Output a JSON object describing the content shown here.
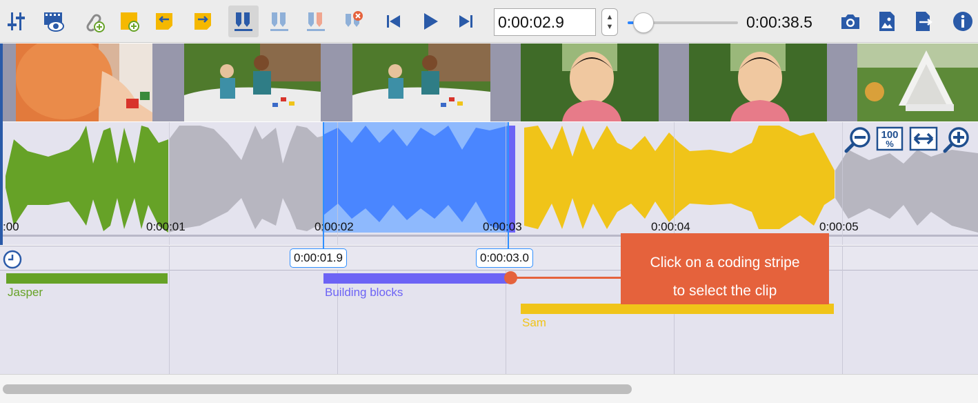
{
  "toolbar": {
    "current_time": "0:00:02.9",
    "total_time": "0:00:38.5",
    "playback_position": 0.075,
    "stepper_up": "▲",
    "stepper_down": "▼",
    "buttons": [
      {
        "name": "sliders-icon"
      },
      {
        "name": "preview-clip-icon"
      },
      {
        "name": "link-add-icon"
      },
      {
        "name": "note-add-icon"
      },
      {
        "name": "note-import-icon"
      },
      {
        "name": "note-export-icon"
      },
      {
        "name": "marker-set-icon"
      },
      {
        "name": "marker-add-icon"
      },
      {
        "name": "marker-split-icon"
      },
      {
        "name": "marker-delete-icon"
      },
      {
        "name": "skip-back-icon"
      },
      {
        "name": "play-icon"
      },
      {
        "name": "skip-forward-icon"
      },
      {
        "name": "camera-icon"
      },
      {
        "name": "image-document-icon"
      },
      {
        "name": "export-document-icon"
      },
      {
        "name": "info-icon"
      }
    ]
  },
  "timeline": {
    "tick_labels": [
      ":00",
      "0:00:01",
      "0:00:02",
      "0:00:03",
      "0:00:04",
      "0:00:05"
    ],
    "selection_start": "0:00:01.9",
    "selection_end": "0:00:03.0"
  },
  "zoom_controls": {
    "zoom_out": "zoom-out-icon",
    "fit_100": "100",
    "fit_100_sub": "%",
    "fit_width": "fit-width-icon",
    "zoom_in": "zoom-in-icon"
  },
  "coding_stripes": [
    {
      "label": "Jasper",
      "color": "#66a227"
    },
    {
      "label": "Building blocks",
      "color": "#6c63f5"
    },
    {
      "label": "Sam",
      "color": "#f0c419"
    }
  ],
  "callout": {
    "line1": "Click on a coding stripe",
    "line2": "to select the clip"
  },
  "colors": {
    "accent": "#2f8fff",
    "callout": "#e5623c",
    "waveform_green": "#66a227",
    "waveform_blue": "#4a86ff",
    "waveform_yellow": "#f0c419",
    "waveform_gray": "#b7b6c0",
    "toolbar_icon_blue": "#2a5aa8",
    "toolbar_icon_yellow": "#f5b800"
  }
}
